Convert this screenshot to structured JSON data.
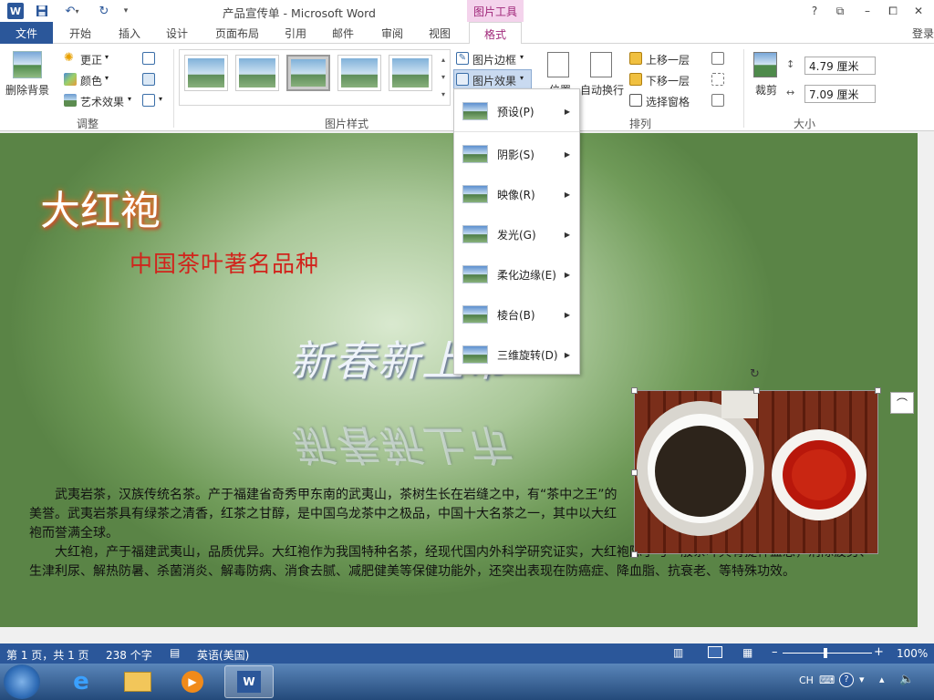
{
  "window": {
    "title": "产品宣传单 - Microsoft Word",
    "context_tab_group": "图片工具",
    "controls": [
      "?",
      "⧉",
      "–",
      "⧠",
      "✕"
    ]
  },
  "tabs": [
    {
      "label": "文件"
    },
    {
      "label": "开始"
    },
    {
      "label": "插入"
    },
    {
      "label": "设计"
    },
    {
      "label": "页面布局"
    },
    {
      "label": "引用"
    },
    {
      "label": "邮件"
    },
    {
      "label": "审阅"
    },
    {
      "label": "视图"
    },
    {
      "label": "格式"
    }
  ],
  "login": "登录",
  "ribbon": {
    "adjust": {
      "remove_bg": "删除背景",
      "corrections": "更正",
      "color": "颜色",
      "art_effects": "艺术效果",
      "group_label": "调整"
    },
    "picture_styles": {
      "group_label": "图片样式"
    },
    "border": "图片边框",
    "effects": "图片效果",
    "arrange": {
      "position": "位置",
      "wrap": "自动换行",
      "bring_forward": "上移一层",
      "send_backward": "下移一层",
      "selection_pane": "选择窗格",
      "group_label": "排列"
    },
    "size": {
      "crop": "裁剪",
      "height": "4.79 厘米",
      "width": "7.09 厘米",
      "group_label": "大小"
    }
  },
  "effects_menu": [
    {
      "label": "预设(P)"
    },
    {
      "label": "阴影(S)"
    },
    {
      "label": "映像(R)"
    },
    {
      "label": "发光(G)"
    },
    {
      "label": "柔化边缘(E)"
    },
    {
      "label": "棱台(B)"
    },
    {
      "label": "三维旋转(D)"
    }
  ],
  "document": {
    "title": "大红袍",
    "subtitle": "中国茶叶著名品种",
    "art_text": "新春新上市",
    "paragraph1": "武夷岩茶，汉族传统名茶。产于福建省奇秀甲东南的武夷山，茶树生长在岩缝之中，有“茶中之王”的美誉。武夷岩茶具有绿茶之清香，红茶之甘醇，是中国乌龙茶中之极品，中国十大名茶之一，其中以大红袍而誉满全球。",
    "paragraph2": "大红袍，产于福建武夷山，品质优异。大红袍作为我国特种名茶，经现代国内外科学研究证实，大红袍除了与一般茶叶具有提神益思，消除疲劳、生津利尿、解热防暑、杀菌消炎、解毒防病、消食去腻、减肥健美等保健功能外，还突出表现在防癌症、降血脂、抗衰老、等特殊功效。"
  },
  "status": {
    "page": "第 1 页，共 1 页",
    "words": "238 个字",
    "language": "英语(美国)",
    "zoom": "100%"
  },
  "taskbar": {
    "ime": "CH"
  }
}
